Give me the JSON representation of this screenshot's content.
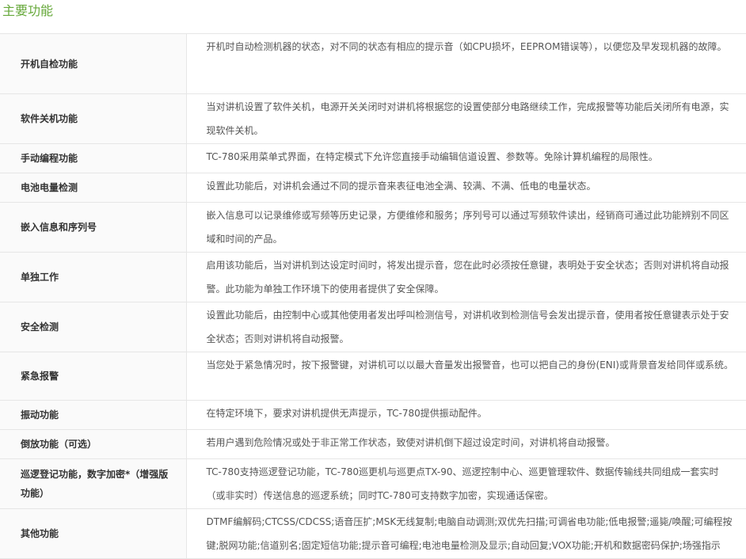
{
  "section": {
    "title": "主要功能"
  },
  "features": [
    {
      "name": "开机自检功能",
      "desc": "开机时自动检测机器的状态，对不同的状态有相应的提示音（如CPU损坏，EEPROM错误等），以便您及早发现机器的故障。",
      "height": 76
    },
    {
      "name": "软件关机功能",
      "desc": "当对讲机设置了软件关机，电源开关关闭时对讲机将根据您的设置使部分电路继续工作，完成报警等功能后关闭所有电源，实现软件关机。",
      "height": 61
    },
    {
      "name": "手动编程功能",
      "desc": "TC-780采用菜单式界面，在特定模式下允许您直接手动编辑信道设置、参数等。免除计算机编程的局限性。",
      "height": 37
    },
    {
      "name": "电池电量检测",
      "desc": "设置此功能后，对讲机会通过不同的提示音来表征电池全满、较满、不满、低电的电量状态。",
      "height": 37
    },
    {
      "name": "嵌入信息和序列号",
      "desc": "嵌入信息可以记录维修或写频等历史记录，方便维修和服务；序列号可以通过写频软件读出，经销商可通过此功能辨别不同区域和时间的产品。",
      "height": 61
    },
    {
      "name": "单独工作",
      "desc": "启用该功能后，当对讲机到达设定时间时，将发出提示音，您在此时必须按任意键，表明处于安全状态；否则对讲机将自动报警。此功能为单独工作环境下的使用者提供了安全保障。",
      "height": 61
    },
    {
      "name": "安全检测",
      "desc": "设置此功能后，由控制中心或其他使用者发出呼叫检测信号，对讲机收到检测信号会发出提示音，使用者按任意键表示处于安全状态；否则对讲机将自动报警。",
      "height": 61
    },
    {
      "name": "紧急报警",
      "desc": "当您处于紧急情况时，按下报警键，对讲机可以以最大音量发出报警音，也可以把自己的身份(ENI)或背景音发给同伴或系统。",
      "height": 61
    },
    {
      "name": "振动功能",
      "desc": "在特定环境下，要求对讲机提供无声提示，TC-780提供振动配件。",
      "height": 37
    },
    {
      "name": "倒放功能（可选）",
      "desc": "若用户遇到危险情况或处于非正常工作状态，致使对讲机倒下超过设定时间，对讲机将自动报警。",
      "height": 37
    },
    {
      "name": "巡逻登记功能，数字加密*（增强版功能）",
      "desc": "TC-780支持巡逻登记功能，TC-780巡更机与巡更点TX-90、巡逻控制中心、巡更管理软件、数据传输线共同组成一套实时（或非实时）传送信息的巡逻系统；同时TC-780可支持数字加密，实现通话保密。",
      "height": 61
    },
    {
      "name": "其他功能",
      "desc": "DTMF编解码;CTCSS/CDCSS;语音压扩;MSK无线复制;电脑自动调测;双优先扫描;可调省电功能;低电报警;遥毙/唤醒;可编程按键;脱网功能;信道别名;固定短信功能;提示音可编程;电池电量检测及显示;自动回复;VOX功能;开机和数据密码保护;场强指示",
      "height": 61
    }
  ]
}
